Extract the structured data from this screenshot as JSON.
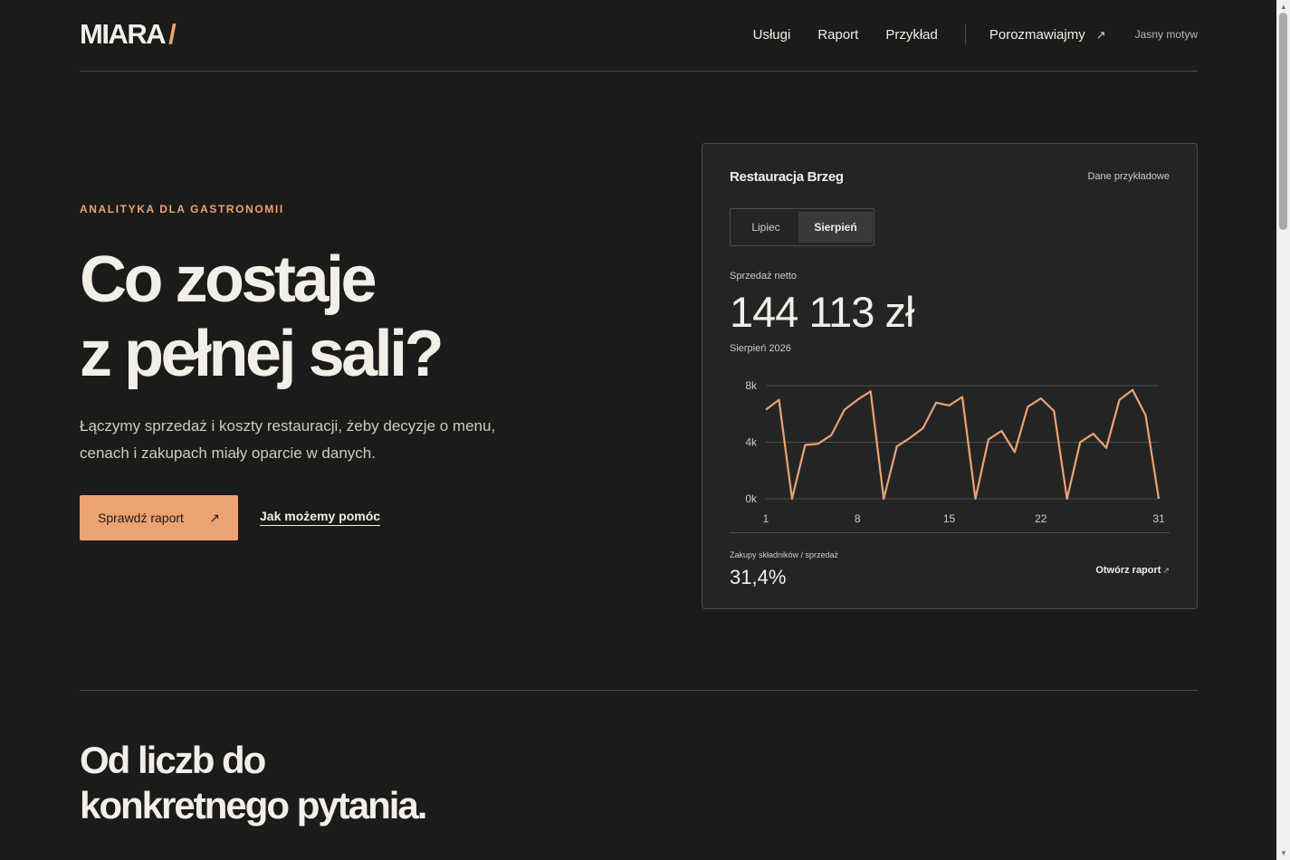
{
  "header": {
    "logo": "MIARA",
    "logo_accent": "/",
    "nav": [
      "Usługi",
      "Raport",
      "Przykład"
    ],
    "cta": "Porozmawiajmy",
    "cta_arrow": "↗",
    "theme_toggle": "Jasny motyw"
  },
  "hero": {
    "eyebrow": "ANALITYKA DLA GASTRONOMII",
    "title_line1": "Co zostaje",
    "title_line2": "z pełnej sali?",
    "description": "Łączymy sprzedaż i koszty restauracji, żeby decyzje o menu, cenach i zakupach miały oparcie w danych.",
    "primary_button": "Sprawdź raport",
    "primary_button_arrow": "↗",
    "secondary_link": "Jak możemy pomóc"
  },
  "card": {
    "title": "Restauracja Brzeg",
    "note": "Dane przykładowe",
    "tabs": [
      "Lipiec",
      "Sierpień"
    ],
    "active_tab": "Sierpień",
    "metric_label": "Sprzedaż netto",
    "metric_value": "144 113 zł",
    "period": "Sierpień 2026",
    "ratio_label": "Zakupy składników / sprzedaż",
    "ratio_value": "31,4%",
    "open_report": "Otwórz raport",
    "open_report_arrow": "↗"
  },
  "chart_data": {
    "type": "line",
    "x": [
      1,
      2,
      3,
      4,
      5,
      6,
      7,
      8,
      9,
      10,
      11,
      12,
      13,
      14,
      15,
      16,
      17,
      18,
      19,
      20,
      21,
      22,
      23,
      24,
      25,
      26,
      27,
      28,
      29,
      30,
      31
    ],
    "values": [
      6300,
      7000,
      0,
      3800,
      3900,
      4500,
      6300,
      7000,
      7600,
      0,
      3700,
      4300,
      5000,
      6800,
      6600,
      7200,
      0,
      4200,
      4800,
      3300,
      6500,
      7100,
      6200,
      0,
      4000,
      4600,
      3600,
      7000,
      7700,
      5900,
      0
    ],
    "ylim": [
      0,
      8000
    ],
    "yticks": [
      "0k",
      "4k",
      "8k"
    ],
    "ytick_values": [
      0,
      4000,
      8000
    ],
    "xticks": [
      "1",
      "8",
      "15",
      "22",
      "31"
    ],
    "xtick_values": [
      1,
      8,
      15,
      22,
      31
    ],
    "grid": true,
    "line_color": "#eda272"
  },
  "section2": {
    "title_line1": "Od liczb do",
    "title_line2": "konkretnego pytania."
  },
  "colors": {
    "background": "#1b1b1a",
    "card": "#232524",
    "accent": "#eda272",
    "text": "#f2efe8"
  }
}
